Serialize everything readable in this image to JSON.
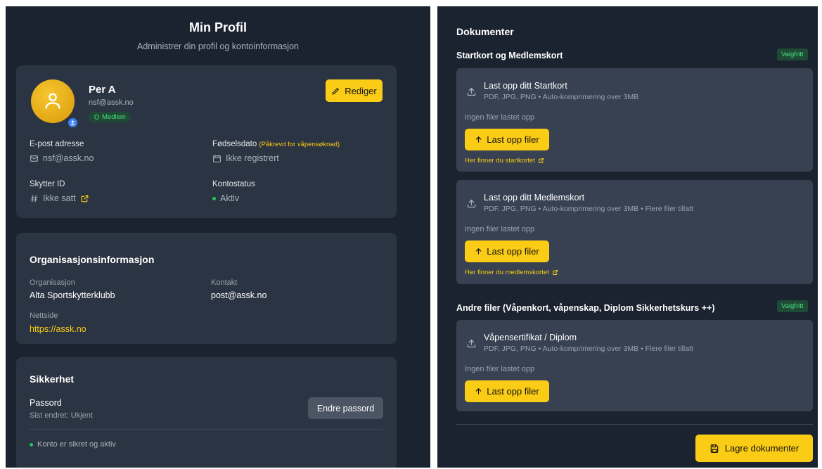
{
  "profile_header": {
    "title": "Min Profil",
    "subtitle": "Administrer din profil og kontoinformasjon"
  },
  "profile": {
    "name": "Per A",
    "email": "nsf@assk.no",
    "role_badge": "Medlem",
    "edit_label": "Rediger",
    "fields": {
      "email_label": "E-post adresse",
      "email_value": "nsf@assk.no",
      "birth_label": "Fødselsdato",
      "birth_required": "(Påkrevd for våpensøknad)",
      "birth_value": "Ikke registrert",
      "shooter_label": "Skytter ID",
      "shooter_value": "Ikke satt",
      "status_label": "Kontostatus",
      "status_value": "Aktiv"
    }
  },
  "organization": {
    "title": "Organisasjonsinformasjon",
    "org_label": "Organisasjon",
    "org_value": "Alta Sportskytterklubb",
    "contact_label": "Kontakt",
    "contact_value": "post@assk.no",
    "website_label": "Nettside",
    "website_value": "https://assk.no"
  },
  "security": {
    "title": "Sikkerhet",
    "password_label": "Passord",
    "last_changed": "Sist endret: Ukjent",
    "change_password_label": "Endre passord",
    "status_text": "Konto er sikret og aktiv"
  },
  "documents": {
    "title": "Dokumenter",
    "sections": [
      {
        "title": "Startkort og Medlemskort",
        "badge": "Valgfritt",
        "cards": [
          {
            "title": "Last opp ditt Startkort",
            "subtitle": "PDF, JPG, PNG • Auto-komprimering over 3MB",
            "empty_text": "Ingen filer lastet opp",
            "button": "Last opp filer",
            "link": "Her finner du startkortet"
          },
          {
            "title": "Last opp ditt Medlemskort",
            "subtitle": "PDF, JPG, PNG • Auto-komprimering over 3MB • Flere filer tillatt",
            "empty_text": "Ingen filer lastet opp",
            "button": "Last opp filer",
            "link": "Her finner du medlemskortet"
          }
        ]
      },
      {
        "title": "Andre filer (Våpenkort, våpenskap, Diplom Sikkerhetskurs ++)",
        "badge": "Valgfritt",
        "cards": [
          {
            "title": "Våpensertifikat / Diplom",
            "subtitle": "PDF, JPG, PNG • Auto-komprimering over 3MB • Flere filer tillatt",
            "empty_text": "Ingen filer lastet opp",
            "button": "Last opp filer"
          }
        ]
      }
    ],
    "save_label": "Lagre dokumenter"
  },
  "colors": {
    "panel_bg": "#1b2330",
    "card_bg": "#2b3442",
    "upload_card_bg": "#374151",
    "accent_yellow": "#facc15",
    "success_green": "#22c55e",
    "link_blue": "#3b82f6"
  },
  "icons": [
    "user-icon",
    "upload-badge-icon",
    "shield-icon",
    "pencil-icon",
    "mail-icon",
    "calendar-icon",
    "hash-icon",
    "external-link-icon",
    "upload-icon",
    "arrow-up-icon",
    "save-icon"
  ]
}
